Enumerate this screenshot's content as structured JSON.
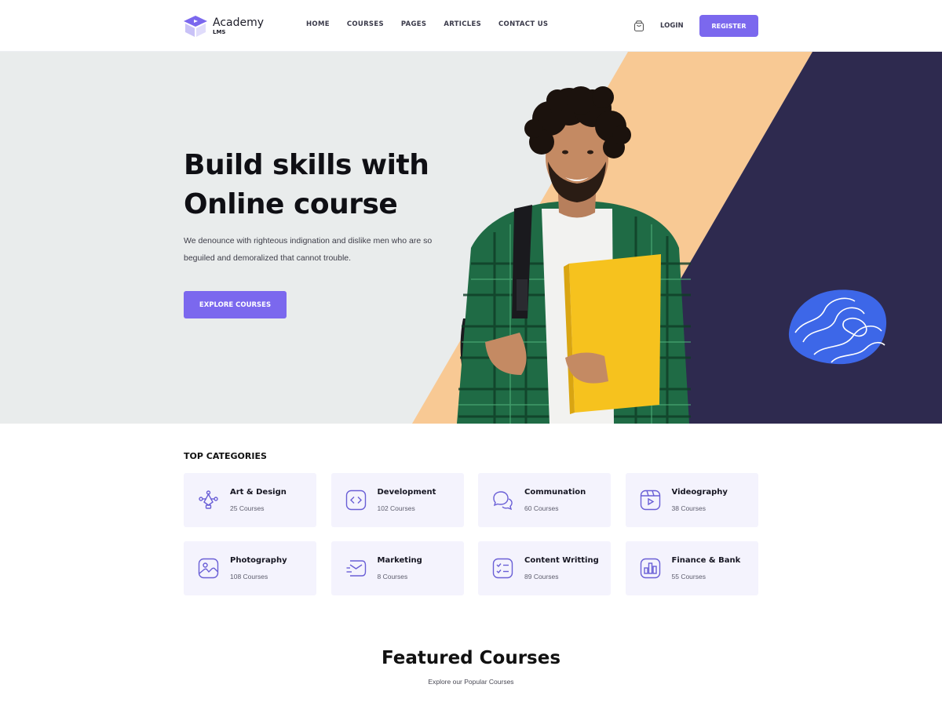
{
  "brand": {
    "name": "Academy",
    "sub": "LMS",
    "logo_icon": "graduation-box-icon",
    "accent": "#7b68ee"
  },
  "nav": {
    "items": [
      {
        "label": "HOME"
      },
      {
        "label": "COURSES"
      },
      {
        "label": "PAGES"
      },
      {
        "label": "ARTICLES"
      },
      {
        "label": "CONTACT US"
      }
    ],
    "cart_icon": "shopping-bag-icon",
    "login_label": "LOGIN",
    "register_label": "REGISTER"
  },
  "hero": {
    "title_line1": "Build skills with",
    "title_line2": "Online course",
    "description": "We denounce with righteous indignation and dislike men who are so beguiled and demoralized that cannot trouble.",
    "cta_label": "EXPLORE COURSES",
    "colors": {
      "background": "#e9ecec",
      "stripe": "#f8c994",
      "panel": "#2e2a4f",
      "blob": "#3d67e8"
    },
    "image": "student-holding-yellow-folder"
  },
  "categories": {
    "heading": "TOP CATEGORIES",
    "items": [
      {
        "name": "Art & Design",
        "count": "25 Courses",
        "icon": "pen-tool-icon"
      },
      {
        "name": "Development",
        "count": "102 Courses",
        "icon": "code-icon"
      },
      {
        "name": "Communation",
        "count": "60 Courses",
        "icon": "chat-bubbles-icon"
      },
      {
        "name": "Videography",
        "count": "38 Courses",
        "icon": "video-icon"
      },
      {
        "name": "Photography",
        "count": "108 Courses",
        "icon": "image-icon"
      },
      {
        "name": "Marketing",
        "count": "8 Courses",
        "icon": "email-icon"
      },
      {
        "name": "Content Writting",
        "count": "89 Courses",
        "icon": "checklist-icon"
      },
      {
        "name": "Finance & Bank",
        "count": "55 Courses",
        "icon": "bar-chart-icon"
      }
    ]
  },
  "featured": {
    "title": "Featured Courses",
    "subtitle": "Explore our Popular Courses"
  }
}
